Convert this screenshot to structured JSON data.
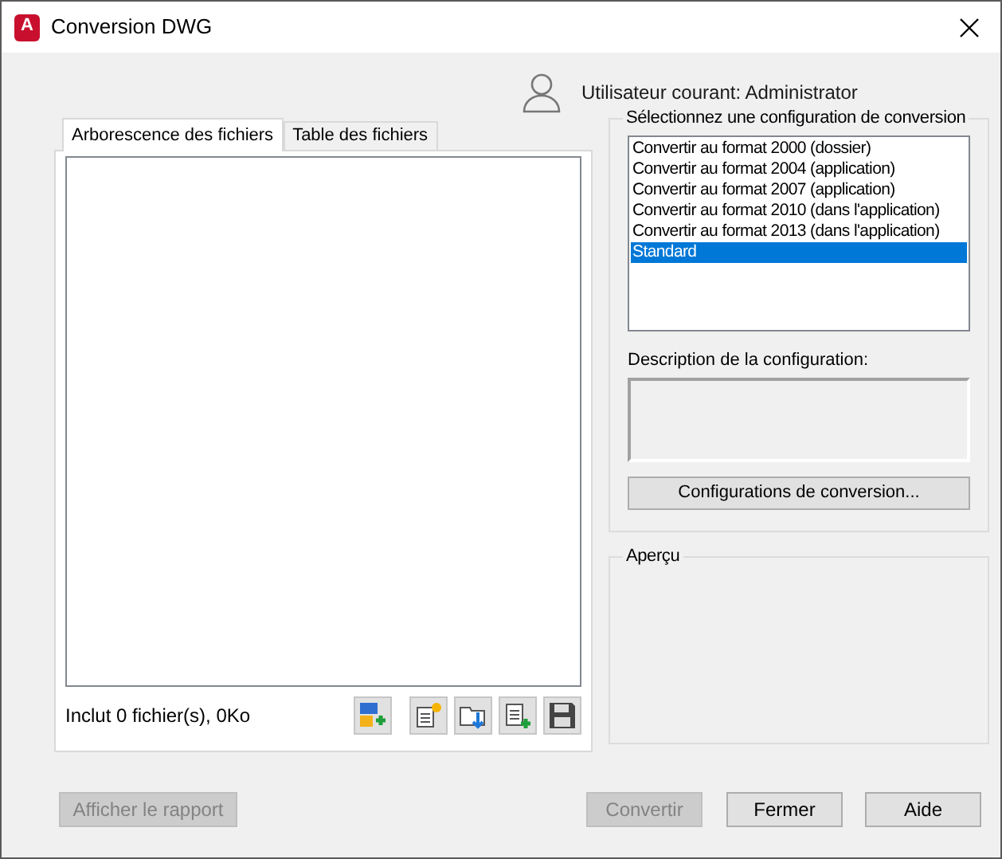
{
  "window": {
    "title": "Conversion DWG",
    "app_badge": "A"
  },
  "user": {
    "label": "Utilisateur courant: Administrator"
  },
  "tabs": [
    {
      "label": "Arborescence des fichiers",
      "selected": true
    },
    {
      "label": "Table des fichiers",
      "selected": false
    }
  ],
  "files": {
    "summary": "Inclut 0 fichier(s), 0Ko"
  },
  "configurations": {
    "title": "Sélectionnez une configuration de conversion",
    "items": [
      {
        "label": "Convertir au format 2000 (dossier)",
        "selected": false
      },
      {
        "label": "Convertir au format 2004 (application)",
        "selected": false
      },
      {
        "label": "Convertir au format 2007 (application)",
        "selected": false
      },
      {
        "label": "Convertir au format 2010 (dans l'application)",
        "selected": false
      },
      {
        "label": "Convertir au format 2013 (dans l'application)",
        "selected": false
      },
      {
        "label": "Standard",
        "selected": true
      }
    ],
    "description_label": "Description de la configuration:",
    "button": "Configurations de conversion..."
  },
  "preview": {
    "title": "Aperçu"
  },
  "buttons": [
    {
      "label": "Afficher le rapport",
      "disabled": true
    },
    {
      "label": "Convertir",
      "disabled": true
    },
    {
      "label": "Fermer",
      "disabled": false
    },
    {
      "label": "Aide",
      "disabled": false
    }
  ]
}
